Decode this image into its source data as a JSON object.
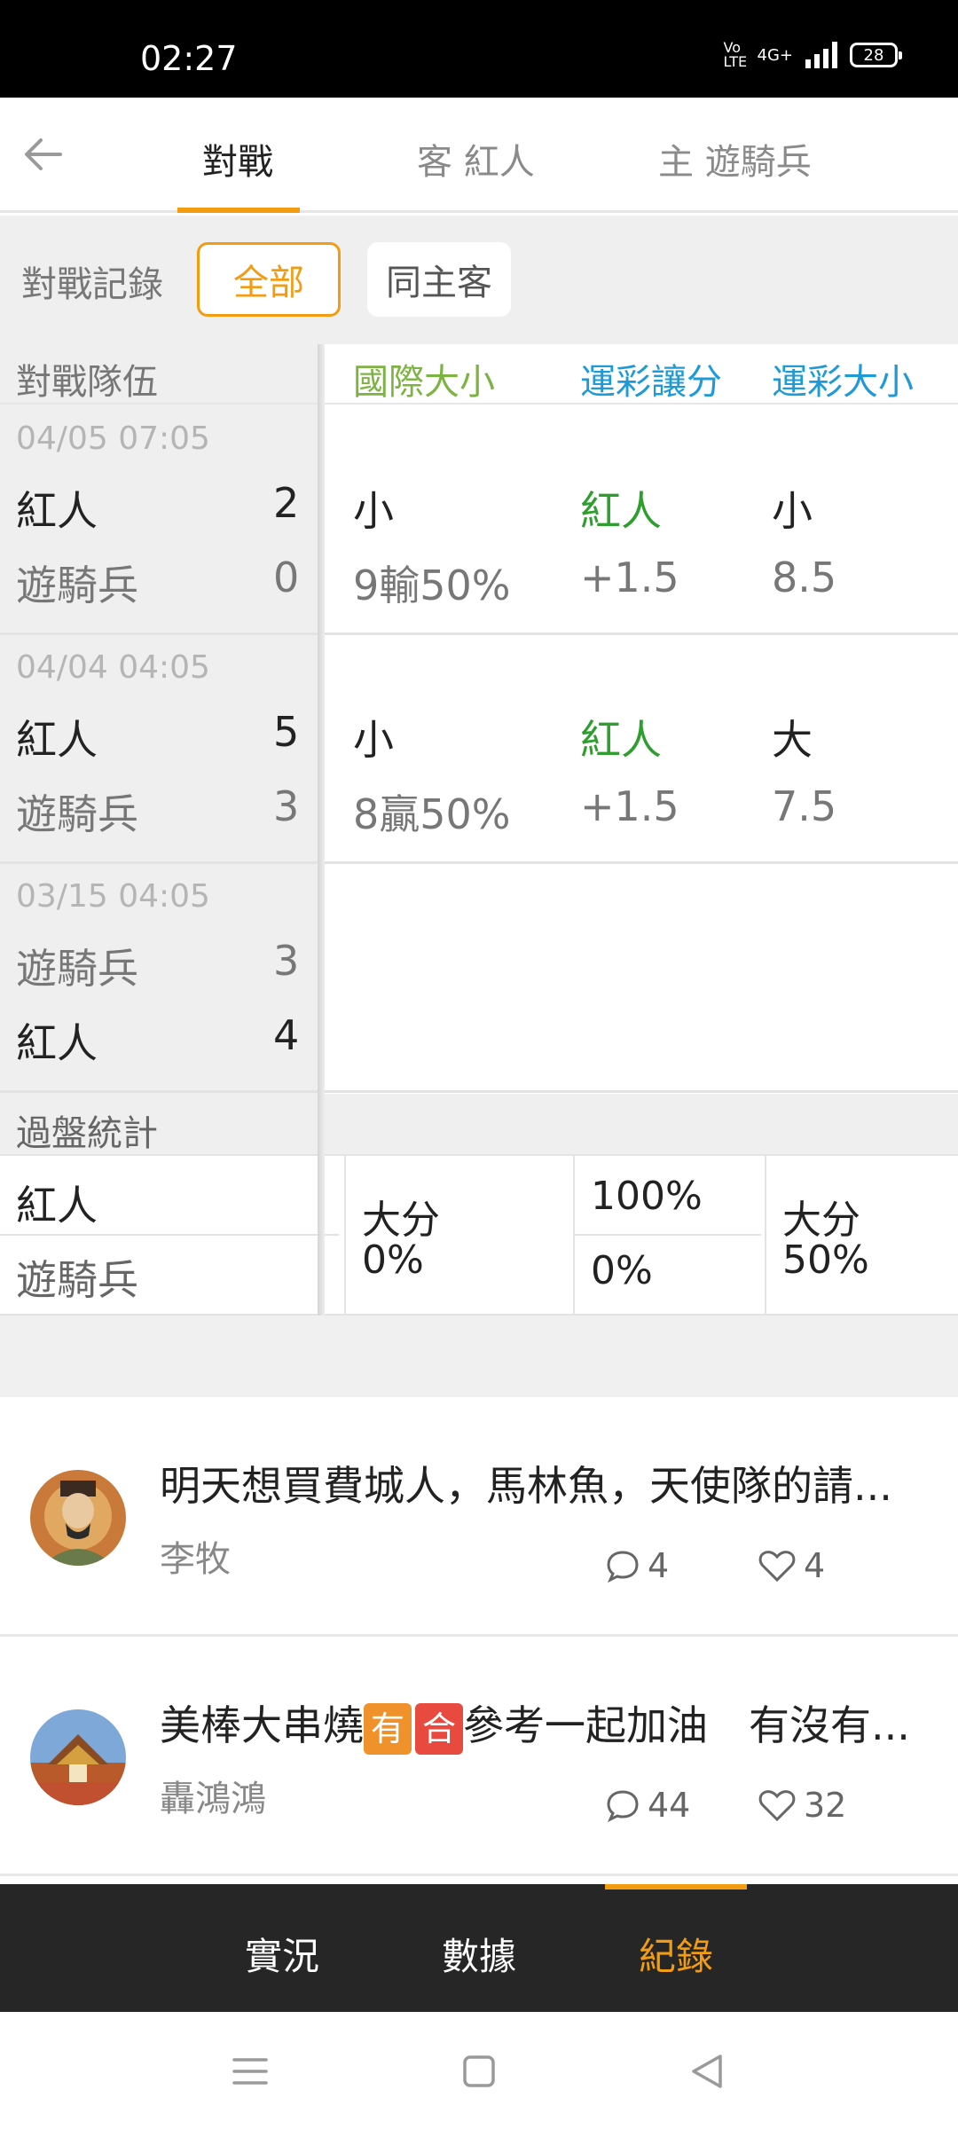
{
  "status_bar": {
    "time": "02:27",
    "network": "4G+",
    "volte": "Vo LTE",
    "battery": "28"
  },
  "header": {
    "tabs": [
      {
        "label": "對戰",
        "active": true
      },
      {
        "label": "客 紅人",
        "active": false
      },
      {
        "label": "主 遊騎兵",
        "active": false
      }
    ]
  },
  "filter": {
    "label": "對戰記錄",
    "options": [
      {
        "label": "全部",
        "selected": true
      },
      {
        "label": "同主客",
        "selected": false
      }
    ]
  },
  "table": {
    "headers": {
      "teams": "對戰隊伍",
      "intl_ou": "國際大小",
      "spread": "運彩讓分",
      "ou": "運彩大小"
    },
    "header_colors": {
      "intl_ou": "#7cb342",
      "spread": "#1e9bd7",
      "ou": "#1e9bd7"
    },
    "matches": [
      {
        "date": "04/05 07:05",
        "team1": "紅人",
        "score1": "2",
        "team2": "遊騎兵",
        "score2": "0",
        "intl_ou": "小",
        "intl_ou_result": "9輸50%",
        "spread_team": "紅人",
        "spread_value": "+1.5",
        "ou": "小",
        "ou_value": "8.5"
      },
      {
        "date": "04/04 04:05",
        "team1": "紅人",
        "score1": "5",
        "team2": "遊騎兵",
        "score2": "3",
        "intl_ou": "小",
        "intl_ou_result": "8贏50%",
        "spread_team": "紅人",
        "spread_value": "+1.5",
        "ou": "大",
        "ou_value": "7.5"
      },
      {
        "date": "03/15 04:05",
        "team1": "遊騎兵",
        "score1": "3",
        "team2": "紅人",
        "score2": "4"
      }
    ],
    "stats": {
      "label": "過盤統計",
      "team1": "紅人",
      "team2": "遊騎兵",
      "intl_label": "大分",
      "intl_value": "0%",
      "spread_top": "100%",
      "spread_bottom": "0%",
      "ou_label": "大分",
      "ou_value": "50%"
    }
  },
  "posts": [
    {
      "title": "明天想買費城人，馬林魚，天使隊的請...",
      "author": "李牧",
      "comments": "4",
      "likes": "4"
    },
    {
      "title_prefix": "美棒大串燒",
      "tag1": "有",
      "tag2": "合",
      "title_suffix": "參考一起加油　有沒有...",
      "author": "轟鴻鴻",
      "comments": "44",
      "likes": "32"
    }
  ],
  "bottom_nav": [
    {
      "label": "實況",
      "active": false
    },
    {
      "label": "數據",
      "active": false
    },
    {
      "label": "紀錄",
      "active": true
    }
  ],
  "colors": {
    "accent": "#f39c12",
    "win_green": "#2e9e2e",
    "tag_orange": "#f0922b",
    "tag_red": "#e84a3f"
  }
}
